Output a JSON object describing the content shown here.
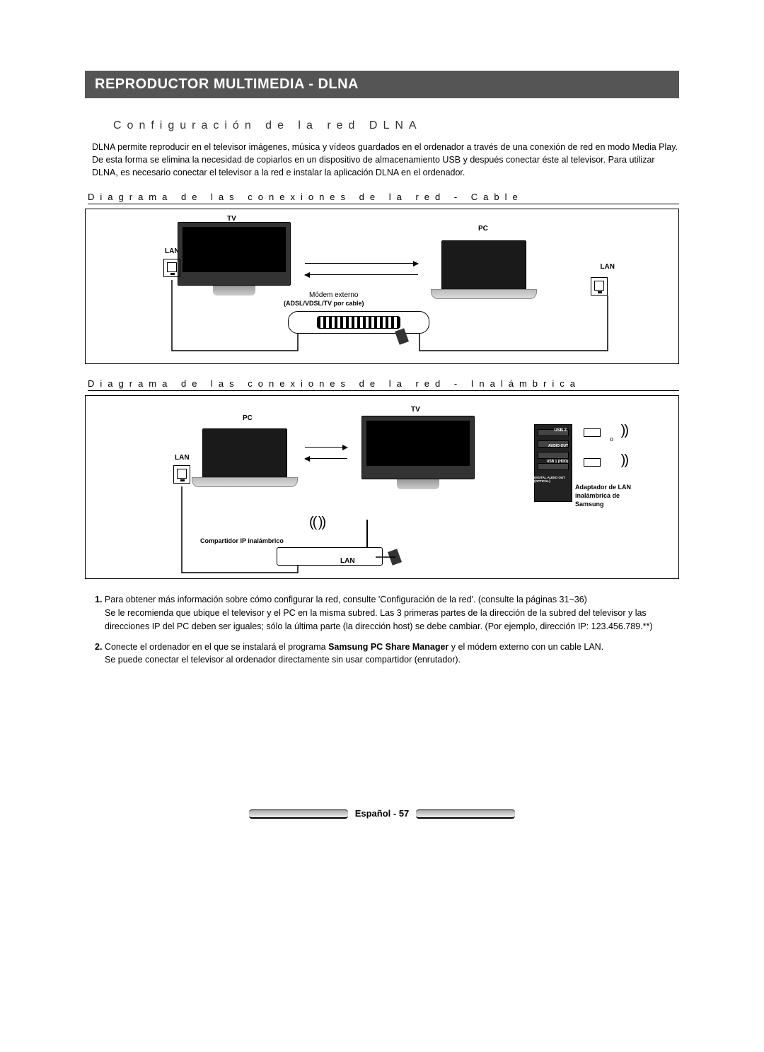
{
  "title_bar": "REPRODUCTOR MULTIMEDIA - DLNA",
  "subtitle": "Configuración de la red DLNA",
  "intro": "DLNA permite reproducir en el televisor imágenes, música y vídeos guardados en el ordenador a través de una conexión de red en modo Media Play. De esta forma se elimina la necesidad de copiarlos en un dispositivo de almacenamiento USB y después conectar éste al televisor. Para utilizar DLNA, es necesario conectar el televisor a la red e instalar la aplicación DLNA en el ordenador.",
  "diagram1_title": "Diagrama de las conexiones de la red - Cable",
  "diagram2_title": "Diagrama de las conexiones de la red - Inalámbrica",
  "labels": {
    "tv": "TV",
    "pc": "PC",
    "lan": "LAN",
    "modem": "Módem externo",
    "modem_sub": "(ADSL/VDSL/TV por cable)",
    "ip_sharer": "Compartidor IP inalámbrico",
    "adapter": "Adaptador de LAN inalámbrica de Samsung",
    "port_usb2": "USB 2",
    "port_audio": "AUDIO OUT",
    "port_usb1": "USB 1 (HDD)",
    "port_digital": "DIGITAL AUDIO OUT (OPTICAL)"
  },
  "notes": {
    "n1_lead": "1.",
    "n1_text": "Para obtener más información sobre cómo configurar la red, consulte 'Configuración de la red'.  (consulte la páginas 31~36)",
    "n1_sub": "Se le recomienda que ubique el televisor y el PC en la misma subred. Las 3 primeras partes de la dirección de la subred del televisor y las direcciones IP del PC deben ser iguales; sólo la última parte (la dirección host) se debe cambiar. (Por ejemplo, dirección IP: 123.456.789.**)",
    "n2_lead": "2.",
    "n2_text_a": "Conecte el ordenador en el que se instalará el programa ",
    "n2_text_bold": "Samsung PC Share Manager",
    "n2_text_b": " y el módem externo con un cable LAN.",
    "n2_sub": "Se puede conectar el televisor al ordenador directamente sin usar compartidor (enrutador)."
  },
  "footer": "Español - 57"
}
